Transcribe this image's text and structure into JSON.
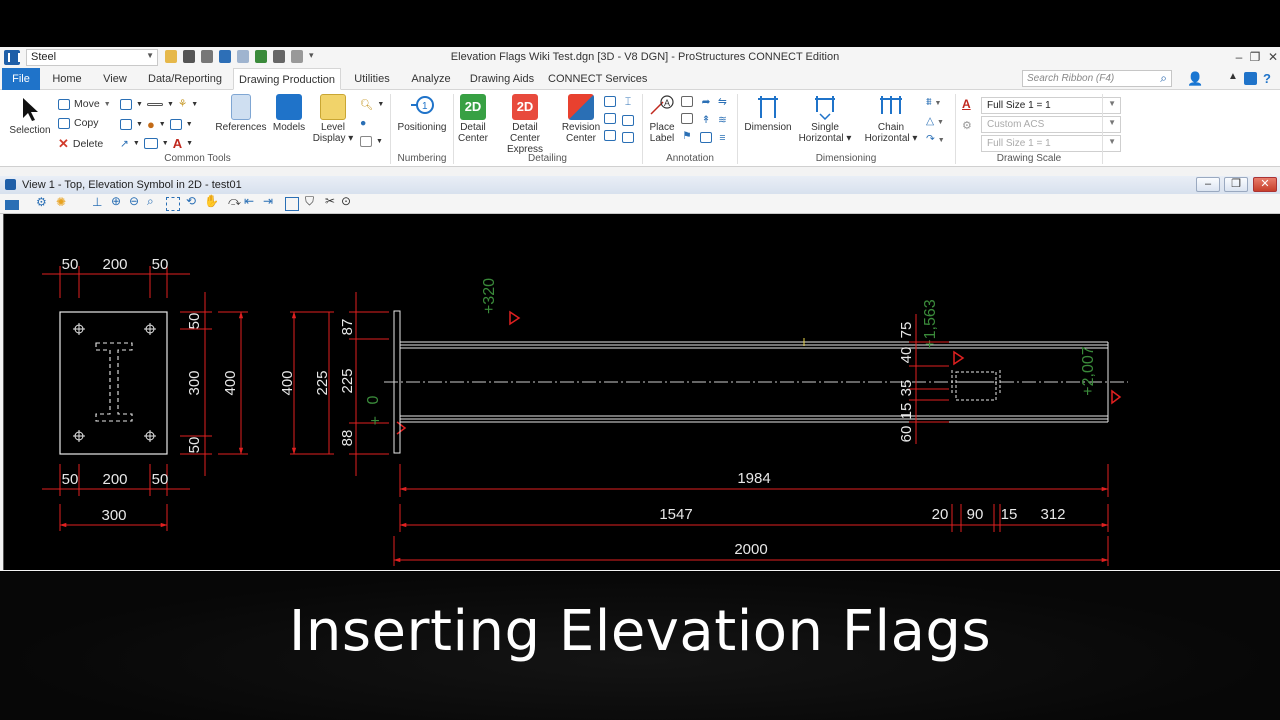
{
  "titlebar": {
    "workspace": "Steel",
    "window_title": "Elevation Flags Wiki Test.dgn [3D - V8 DGN] - ProStructures CONNECT Edition"
  },
  "tabs": [
    "File",
    "Home",
    "View",
    "Data/Reporting",
    "Drawing Production",
    "Utilities",
    "Analyze",
    "Drawing Aids",
    "CONNECT Services"
  ],
  "active_tab": "Drawing Production",
  "search": {
    "placeholder": "Search Ribbon (F4)"
  },
  "ribbon": {
    "common_tools": {
      "label": "Common Tools",
      "selection": "Selection",
      "move": "Move",
      "copy": "Copy",
      "delete": "Delete",
      "references": "References",
      "models": "Models",
      "level_display_1": "Level",
      "level_display_2": "Display"
    },
    "numbering": {
      "label": "Numbering",
      "positioning": "Positioning"
    },
    "detailing": {
      "label": "Detailing",
      "detail_center_1": "Detail",
      "detail_center_2": "Center",
      "detail_express_1": "Detail",
      "detail_express_2": "Center Express",
      "revision_center_1": "Revision",
      "revision_center_2": "Center",
      "badge_2d": "2D"
    },
    "annotation": {
      "label": "Annotation",
      "place_label_1": "Place",
      "place_label_2": "Label"
    },
    "dimensioning": {
      "label": "Dimensioning",
      "dimension": "Dimension",
      "single_1": "Single",
      "single_2": "Horizontal",
      "chain_1": "Chain",
      "chain_2": "Horizontal"
    },
    "drawing_scale": {
      "label": "Drawing Scale",
      "scale": "Full Size 1 = 1",
      "acs": "Custom ACS",
      "scale2": "Full Size 1 = 1"
    }
  },
  "view": {
    "title": "View 1 - Top, Elevation Symbol in 2D - test01"
  },
  "drawing": {
    "plate_dims_top": [
      "50",
      "200",
      "50"
    ],
    "plate_dims_bottom": [
      "50",
      "200",
      "50"
    ],
    "plate_width": "300",
    "plate_right_dims": [
      "50",
      "300",
      "50"
    ],
    "plate_height": "400",
    "elev_dims": [
      "87",
      "225",
      "88"
    ],
    "elev_225": "225",
    "elev_400": "400",
    "zero_label": "0",
    "elev_320": "+320",
    "elev_1563": "+1,563",
    "elev_2007": "+2,007",
    "right_dims": [
      "75",
      "40",
      "35",
      "15",
      "60"
    ],
    "length_1984": "1984",
    "dim_1547": "1547",
    "dim_20": "20",
    "dim_90": "90",
    "dim_15": "15",
    "dim_312": "312",
    "length_2000": "2000"
  },
  "caption": "Inserting Elevation Flags",
  "colors": {
    "accent": "#1f73c9",
    "dimension_red": "#e02020",
    "elevation_green": "#3a8a3a",
    "background": "#000000"
  }
}
